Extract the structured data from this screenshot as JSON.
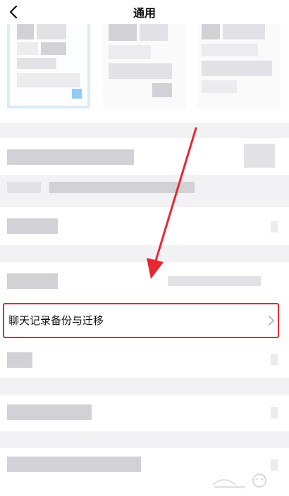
{
  "header": {
    "title": "通用",
    "back_icon": "chevron-left-icon"
  },
  "settings": {
    "chat_backup_label": "聊天记录备份与迁移",
    "chevron_icon": "chevron-right-icon"
  },
  "annotation": {
    "arrow_color": "#e8272f",
    "highlight_color": "#e8272f"
  },
  "watermark": {
    "logo": "baidu-jingyan-watermark"
  }
}
